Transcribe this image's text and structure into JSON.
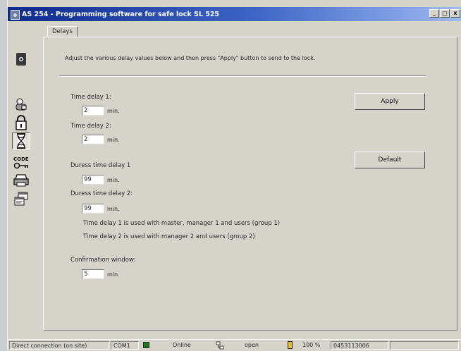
{
  "window": {
    "title": "AS 254 - Programming software for safe lock SL 525",
    "min": "_",
    "max": "□",
    "close": "x"
  },
  "tab": {
    "label": "Delays"
  },
  "toolbar": {
    "code_label": "CODE"
  },
  "intro": "Adjust the various delay values below and then press \"Apply\" button to send to the lock.",
  "fields": {
    "time_delay_1": {
      "label": "Time delay 1:",
      "value": "2",
      "unit": "min."
    },
    "time_delay_2": {
      "label": "Time delay 2:",
      "value": "2",
      "unit": "min."
    },
    "duress_delay_1": {
      "label": "Duress time delay 1",
      "value": "99",
      "unit": "min."
    },
    "duress_delay_2": {
      "label": "Duress time delay 2:",
      "value": "99",
      "unit": "min."
    },
    "confirmation": {
      "label": "Confirmation window:",
      "value": "5",
      "unit": "min."
    }
  },
  "notes": {
    "line1": "Time delay 1 is used with master, manager 1 and users (group 1)",
    "line2": "Time delay 2 is used with manager 2 and users (group 2)"
  },
  "buttons": {
    "apply": "Apply",
    "default": "Default"
  },
  "status": {
    "connection": "Direct connection (on site)",
    "port": "COM1",
    "state": "Online",
    "lock": "open",
    "battery": "100 %",
    "serial": "0453113006"
  },
  "colors": {
    "online_indicator": "#1e7a1e",
    "battery_indicator": "#e8c020"
  }
}
